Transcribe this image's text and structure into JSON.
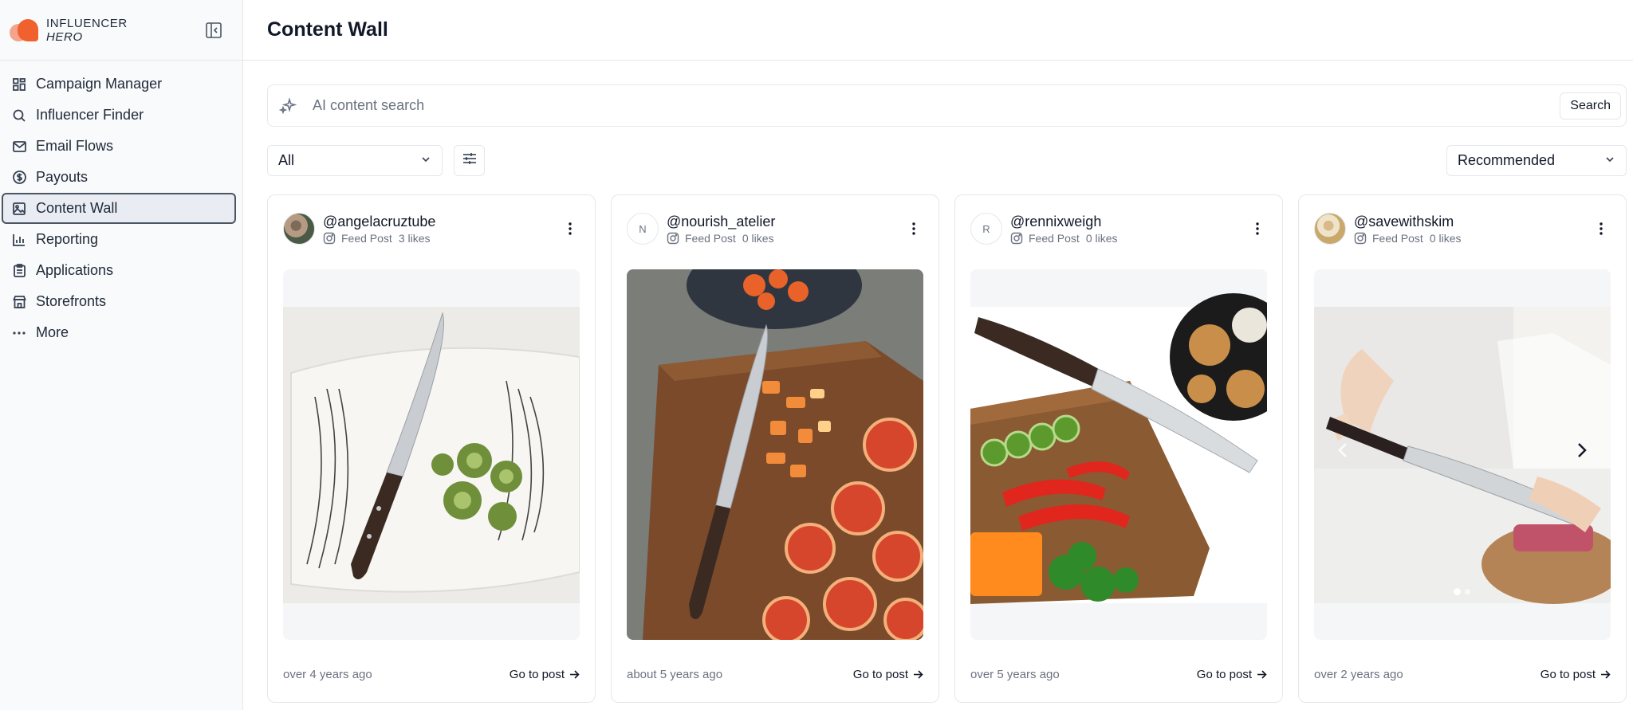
{
  "brand": {
    "line1": "INFLUENCER",
    "line2": "HERO"
  },
  "sidebar": {
    "items": [
      {
        "label": "Campaign Manager",
        "icon": "grid-icon"
      },
      {
        "label": "Influencer Finder",
        "icon": "search-icon"
      },
      {
        "label": "Email Flows",
        "icon": "mail-icon"
      },
      {
        "label": "Payouts",
        "icon": "dollar-circle-icon"
      },
      {
        "label": "Content Wall",
        "icon": "image-icon",
        "active": true
      },
      {
        "label": "Reporting",
        "icon": "bar-chart-icon"
      },
      {
        "label": "Applications",
        "icon": "clipboard-icon"
      },
      {
        "label": "Storefronts",
        "icon": "store-icon"
      },
      {
        "label": "More",
        "icon": "ellipsis-icon"
      }
    ]
  },
  "header": {
    "title": "Content Wall"
  },
  "search": {
    "placeholder": "AI content search",
    "value": "",
    "button_label": "Search"
  },
  "filters": {
    "type_selected": "All",
    "sort_selected": "Recommended"
  },
  "cards": [
    {
      "handle": "@angelacruztube",
      "avatar_initial": "",
      "post_type": "Feed Post",
      "likes": "3 likes",
      "time": "over 4 years ago",
      "cta": "Go to post"
    },
    {
      "handle": "@nourish_atelier",
      "avatar_initial": "N",
      "post_type": "Feed Post",
      "likes": "0 likes",
      "time": "about 5 years ago",
      "cta": "Go to post"
    },
    {
      "handle": "@rennixweigh",
      "avatar_initial": "R",
      "post_type": "Feed Post",
      "likes": "0 likes",
      "time": "over 5 years ago",
      "cta": "Go to post"
    },
    {
      "handle": "@savewithskim",
      "avatar_initial": "",
      "post_type": "Feed Post",
      "likes": "0 likes",
      "time": "over 2 years ago",
      "cta": "Go to post"
    }
  ],
  "colors": {
    "accent": "#f0612e",
    "active_border": "#4b5563",
    "sidebar_bg": "#f8fafc"
  }
}
